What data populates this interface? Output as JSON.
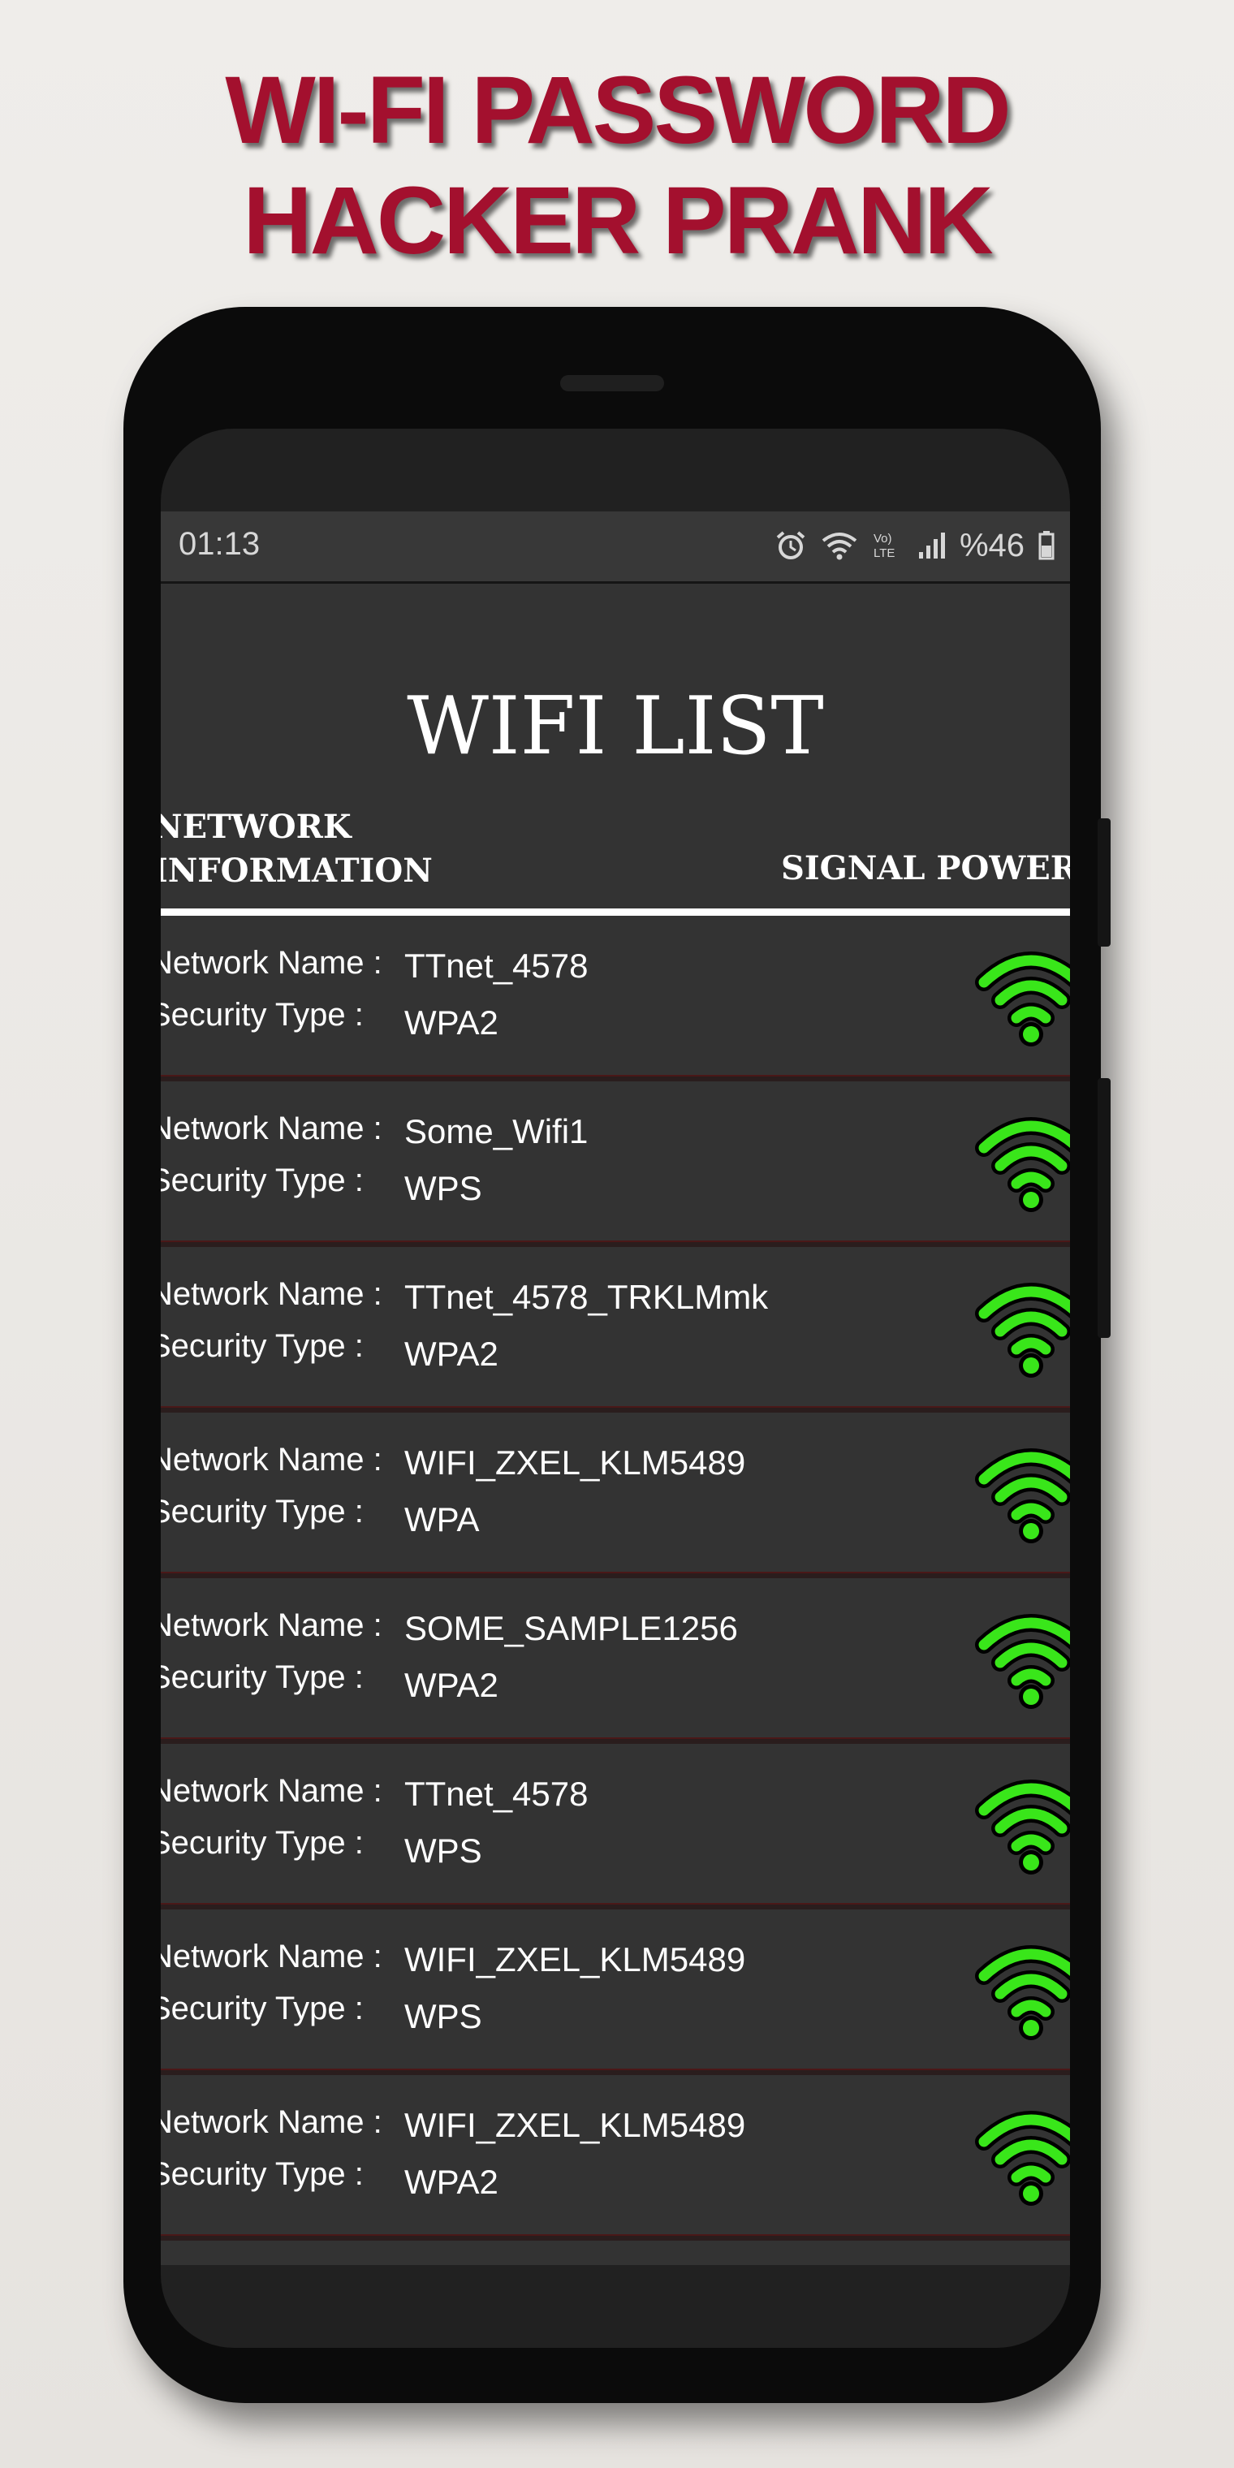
{
  "promo": {
    "line1": "WI-FI PASSWORD",
    "line2": "HACKER PRANK"
  },
  "statusbar": {
    "time": "01:13",
    "battery": "%46",
    "icons": [
      "alarm-icon",
      "wifi-icon",
      "volte-icon",
      "cell-signal-icon",
      "battery-icon"
    ]
  },
  "screen": {
    "title": "WIFI LIST",
    "header_left_1": "NETWORK",
    "header_left_2": "INFORMATION",
    "header_right": "SIGNAL POWER",
    "name_label": "Network Name :",
    "security_label": "Security Type :"
  },
  "networks": [
    {
      "name": "TTnet_4578",
      "security": "WPA2"
    },
    {
      "name": "Some_Wifi1",
      "security": "WPS"
    },
    {
      "name": "TTnet_4578_TRKLMmk",
      "security": "WPA2"
    },
    {
      "name": "WIFI_ZXEL_KLM5489",
      "security": "WPA"
    },
    {
      "name": "SOME_SAMPLE1256",
      "security": "WPA2"
    },
    {
      "name": "TTnet_4578",
      "security": "WPS"
    },
    {
      "name": "WIFI_ZXEL_KLM5489",
      "security": "WPS"
    },
    {
      "name": "WIFI_ZXEL_KLM5489",
      "security": "WPA2"
    }
  ],
  "colors": {
    "headline": "#a3102e",
    "signal": "#39e61a",
    "screen_bg": "#333333"
  }
}
